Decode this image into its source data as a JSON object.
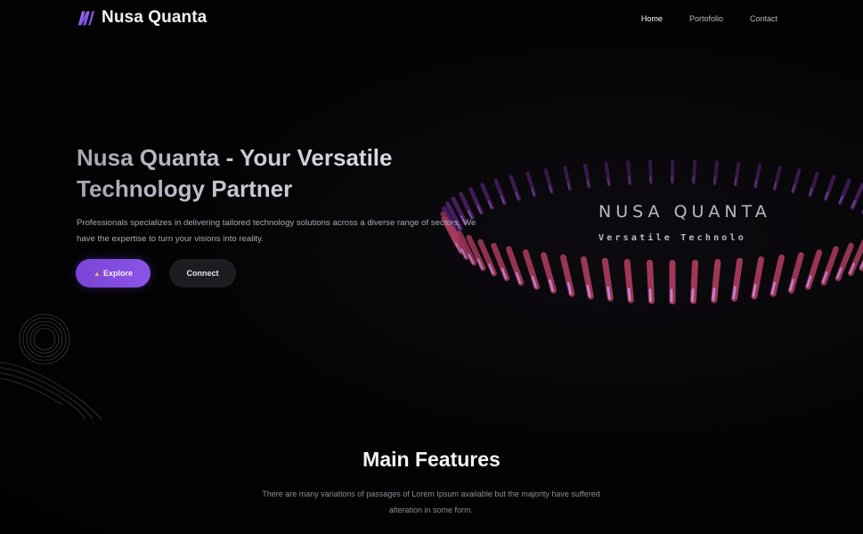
{
  "header": {
    "brand_name": "Nusa Quanta",
    "brand_logo_icon": "nq-logo-icon",
    "nav": [
      {
        "label": "Home",
        "active": true
      },
      {
        "label": "Portofolio",
        "active": false
      },
      {
        "label": "Contact",
        "active": false
      }
    ]
  },
  "hero": {
    "title_line1": "Nusa Quanta -  Your Versatile",
    "title_line2": "Technology Partner",
    "description": "Professionals specializes in delivering tailored technology solutions across a diverse range of sectors. We have the expertise to turn your visions into reality.",
    "explore_icon": "rocket-icon",
    "explore_label": "Explore",
    "connect_label": "Connect",
    "overlay_title": "NUSA QUANTA",
    "overlay_subtitle": "Versatile Technolo"
  },
  "features": {
    "title": "Main Features",
    "description": "There are many variations of passages of Lorem Ipsum available but the majority have suffered alteration in some form."
  },
  "colors": {
    "accent": "#7c48d8",
    "background": "#020203",
    "ring_front": "#a83a5a",
    "ring_back": "#6a2a8a"
  }
}
